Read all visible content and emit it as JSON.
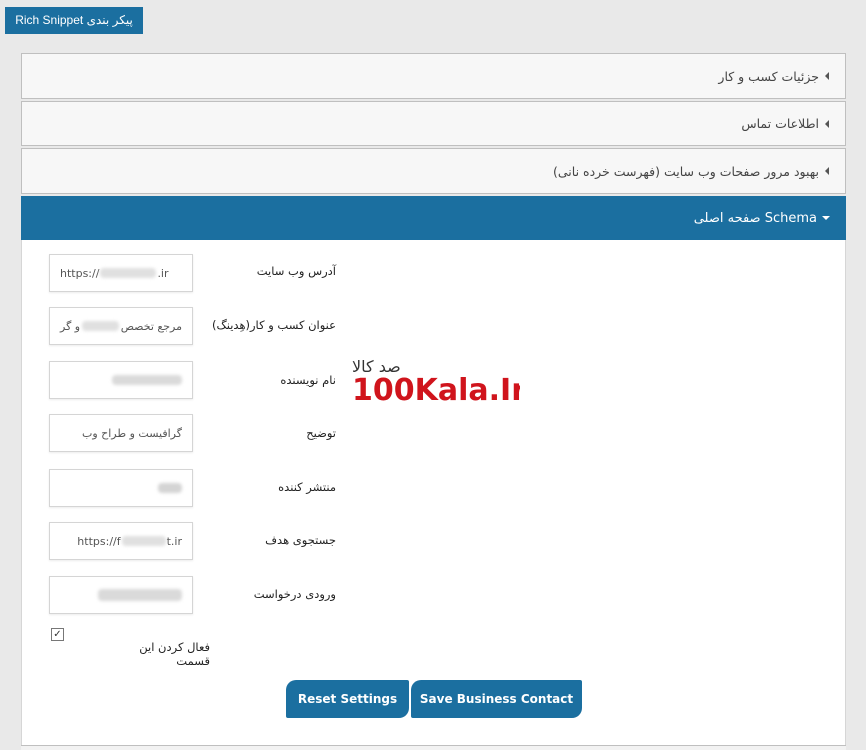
{
  "top_button": {
    "label": "پیکر بندی Rich Snippet"
  },
  "accordions": [
    {
      "title": "جزئیات کسب و کار"
    },
    {
      "title": "اطلاعات تماس"
    },
    {
      "title": "بهبود مرور صفحات وب سایت (فهرست خرده نانی)"
    }
  ],
  "schema": {
    "title": "Schema صفحه اصلی",
    "fields": [
      {
        "label": "آدرس وب سایت",
        "value": "https://",
        "value_tail": ".ir"
      },
      {
        "label": "عنوان کسب و کار(هِدینگ)",
        "value": "مرجع تخصص",
        "value_tail": "و گر"
      },
      {
        "label": "نام نویسنده",
        "value": "",
        "value_tail": ""
      },
      {
        "label": "توضیح",
        "value": "گرافیست و طراح وب",
        "value_tail": ""
      },
      {
        "label": "منتشر کننده",
        "value": "",
        "value_tail": ""
      },
      {
        "label": "جستجوی هدف",
        "value": "https://f",
        "value_tail": "t.ir"
      },
      {
        "label": "ورودی درخواست",
        "value": "",
        "value_tail": ""
      }
    ],
    "enable_label": "فعال کردن این قسمت",
    "enable_checked": true,
    "reset_label": "Reset Settings",
    "save_label": "Save Business Contact"
  },
  "watermark": {
    "text": "100Kala.Ir",
    "persian": "صد کالا"
  },
  "colors": {
    "primary": "#1b6fa0",
    "panel_bg": "#f7f7f7",
    "page_bg": "#e9e9e9",
    "logo_red": "#d0141c"
  }
}
